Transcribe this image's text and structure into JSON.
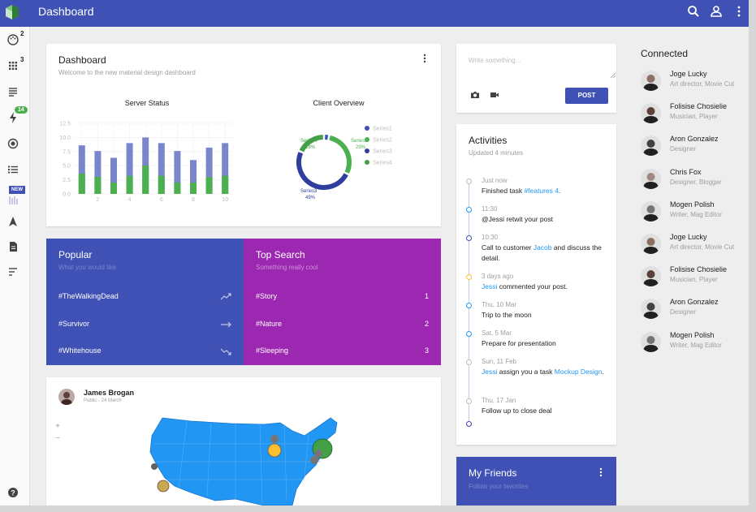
{
  "app": {
    "title": "Dashboard"
  },
  "sidebar": {
    "badges": {
      "palette": "2",
      "apps": "3",
      "flash": "14",
      "new": "NEW"
    }
  },
  "dashboard_card": {
    "title": "Dashboard",
    "subtitle": "Welcome to the new material design dashboard"
  },
  "chart_data": [
    {
      "type": "bar",
      "title": "Server Status",
      "x": [
        1,
        2,
        3,
        4,
        5,
        6,
        7,
        8,
        9,
        10
      ],
      "x_tick_labels": [
        "2",
        "4",
        "6",
        "8",
        "10"
      ],
      "y_ticks": [
        "0.0",
        "2.5",
        "5.0",
        "7.5",
        "10.0",
        "12.5"
      ],
      "ylim": [
        0,
        12.5
      ],
      "series": [
        {
          "values": [
            5.0,
            4.6,
            4.4,
            5.8,
            5.0,
            5.8,
            5.6,
            4.0,
            5.2,
            5.8
          ]
        },
        {
          "values": [
            3.6,
            3.0,
            2.0,
            3.2,
            5.0,
            3.2,
            2.0,
            2.0,
            3.0,
            3.2
          ]
        }
      ],
      "colors": [
        "#7986cb",
        "#4caf50"
      ],
      "grid": true
    },
    {
      "type": "pie",
      "title": "Client Overview",
      "donut": true,
      "slices": [
        {
          "name": "Series1",
          "value": 3,
          "color": "#3f51b5"
        },
        {
          "name": "Series2",
          "value": 29,
          "label": "29%",
          "color": "#4caf50"
        },
        {
          "name": "Series3",
          "value": 49,
          "label": "49%",
          "color": "#303f9f"
        },
        {
          "name": "Series4",
          "value": 18,
          "label": "18%",
          "color": "#43a047"
        }
      ],
      "legend": [
        "Series1",
        "Series2",
        "Series3",
        "Series4"
      ],
      "legend_position": "right"
    }
  ],
  "popular": {
    "title": "Popular",
    "subtitle": "What you would like",
    "items": [
      {
        "label": "#TheWalkingDead",
        "trend": "up"
      },
      {
        "label": "#Survivor",
        "trend": "flat"
      },
      {
        "label": "#Whitehouse",
        "trend": "down"
      }
    ]
  },
  "top_search": {
    "title": "Top Search",
    "subtitle": "Something really cool",
    "items": [
      {
        "label": "#Story",
        "value": "1"
      },
      {
        "label": "#Nature",
        "value": "2"
      },
      {
        "label": "#Sleeping",
        "value": "3"
      }
    ]
  },
  "post": {
    "placeholder": "Write something...",
    "button": "POST"
  },
  "activities": {
    "title": "Activities",
    "subtitle": "Updated 4 minutes",
    "items": [
      {
        "time": "Just now",
        "text_before": "Finished task ",
        "highlight": "#features 4",
        "text_after": "."
      },
      {
        "time": "11:30",
        "text_before": "@Jessi retwit your post",
        "highlight": "",
        "text_after": ""
      },
      {
        "time": "10:30",
        "text_before": "Call to customer ",
        "highlight": "Jacob",
        "text_after": " and discuss the detail."
      },
      {
        "time": "3 days ago",
        "text_before": "",
        "highlight": "Jessi",
        "text_after": " commented your post."
      },
      {
        "time": "Thu, 10 Mar",
        "text_before": "Trip to the moon",
        "highlight": "",
        "text_after": ""
      },
      {
        "time": "Sat, 5 Mar",
        "text_before": "Prepare for presentation",
        "highlight": "",
        "text_after": ""
      },
      {
        "time": "Sun, 11 Feb",
        "text_before": "",
        "highlight": "Jessi",
        "text_after": " assign you a task ",
        "highlight2": "Mockup Design",
        "text_end": "."
      },
      {
        "time": "Thu, 17 Jan",
        "text_before": "Follow up to close deal",
        "highlight": "",
        "text_after": ""
      }
    ]
  },
  "friends": {
    "title": "My Friends",
    "subtitle": "Follow your favorites"
  },
  "connected": {
    "title": "Connected",
    "people": [
      {
        "name": "Joge Lucky",
        "role": "Art director, Movie Cut"
      },
      {
        "name": "Folisise Chosielie",
        "role": "Musician, Player"
      },
      {
        "name": "Aron Gonzalez",
        "role": "Designer"
      },
      {
        "name": "Chris Fox",
        "role": "Designer, Blogger"
      },
      {
        "name": "Mogen Polish",
        "role": "Writer, Mag Editor"
      },
      {
        "name": "Joge Lucky",
        "role": "Art director, Movie Cut"
      },
      {
        "name": "Folisise Chosielie",
        "role": "Musician, Player"
      },
      {
        "name": "Aron Gonzalez",
        "role": "Designer"
      },
      {
        "name": "Mogen Polish",
        "role": "Writer, Mag Editor"
      }
    ]
  },
  "map_card": {
    "name": "James Brogan",
    "meta": "Public - 24 March",
    "zoom_in": "+",
    "zoom_out": "−"
  },
  "colors": {
    "primary": "#3f51b5",
    "accent_purple": "#9c27b0",
    "green": "#4caf50",
    "link": "#2196f3",
    "map_land": "#2196f3",
    "badge_green": "#4caf50"
  }
}
